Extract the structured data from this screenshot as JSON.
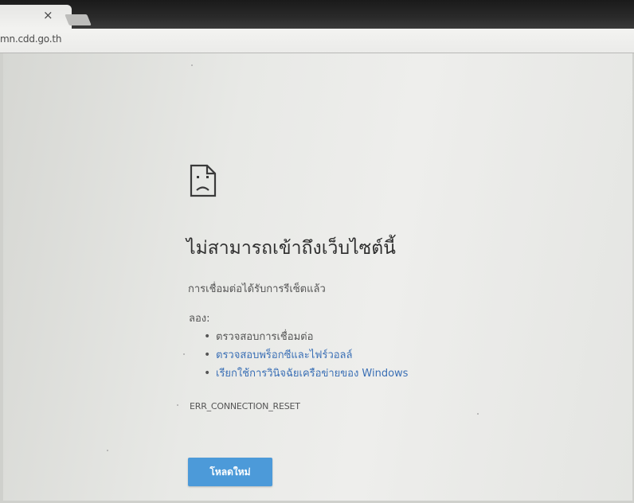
{
  "browser": {
    "tab_close_label": "×",
    "address_bar_text": "mn.cdd.go.th"
  },
  "error_page": {
    "icon": "sad-page-icon",
    "title": "ไม่สามารถเข้าถึงเว็บไซต์นี้",
    "subtitle": "การเชื่อมต่อได้รับการรีเซ็ตแล้ว",
    "try_label": "ลอง:",
    "suggestions": [
      "ตรวจสอบการเชื่อมต่อ",
      "ตรวจสอบพร็อกซีและไฟร์วอลล์",
      "เรียกใช้การวินิจฉัยเครือข่ายของ Windows"
    ],
    "error_code": "ERR_CONNECTION_RESET",
    "reload_button_label": "โหลดใหม่"
  },
  "colors": {
    "link": "#3a6fb5",
    "button": "#4c9ad9",
    "text": "#2e2e2e"
  }
}
